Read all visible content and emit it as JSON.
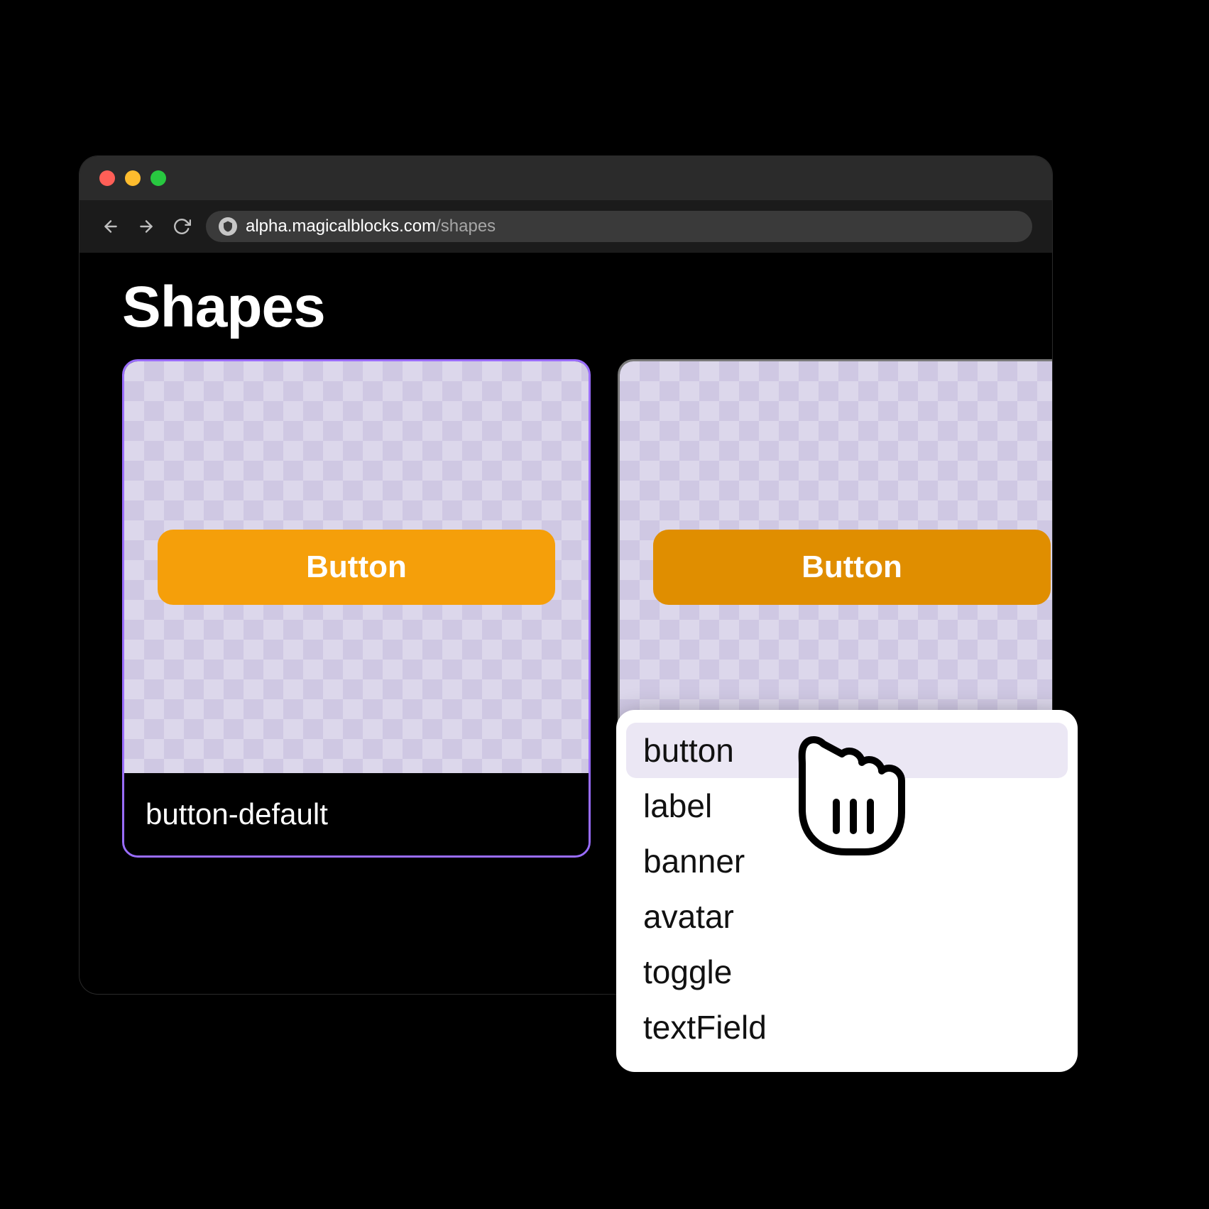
{
  "browser": {
    "url_host": "alpha.magicalblocks.com",
    "url_path": "/shapes"
  },
  "page": {
    "title": "Shapes"
  },
  "cards": [
    {
      "preview_label": "Button",
      "name": "button-default"
    },
    {
      "preview_label": "Button",
      "name": ""
    }
  ],
  "dropdown": {
    "items": [
      "button",
      "label",
      "banner",
      "avatar",
      "toggle",
      "textField"
    ],
    "hovered_index": 0
  },
  "colors": {
    "accent_purple": "#9a6dff",
    "button_orange": "#f59f0a",
    "button_orange_hover": "#e08e00"
  }
}
